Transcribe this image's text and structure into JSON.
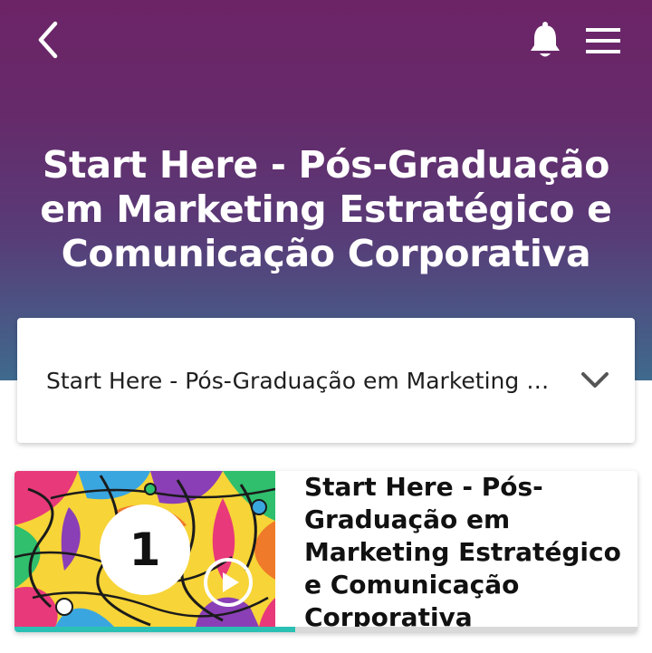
{
  "header": {
    "back_icon": "chevron-left-icon",
    "notifications_icon": "bell-icon",
    "menu_icon": "hamburger-menu-icon",
    "title": "Start Here - Pós-Graduação em Marketing Estratégico e Comunicação Corporativa"
  },
  "module_select": {
    "selected": "Start Here - Pós-Graduação em Marketing Estratégico e Comunicação Corporativa",
    "icon": "chevron-down-icon"
  },
  "lesson": {
    "number": "1",
    "title": "Start Here - Pós-Graduação em Marketing Estratégico e Comunicação Corporativa",
    "progress_percent": 45,
    "play_icon": "play-circle-icon"
  },
  "colors": {
    "header_gradient_top": "#6c2467",
    "header_gradient_bottom": "#3f6a8e",
    "progress_fill": "#2bc0b4",
    "progress_track": "#d9d9d9"
  }
}
